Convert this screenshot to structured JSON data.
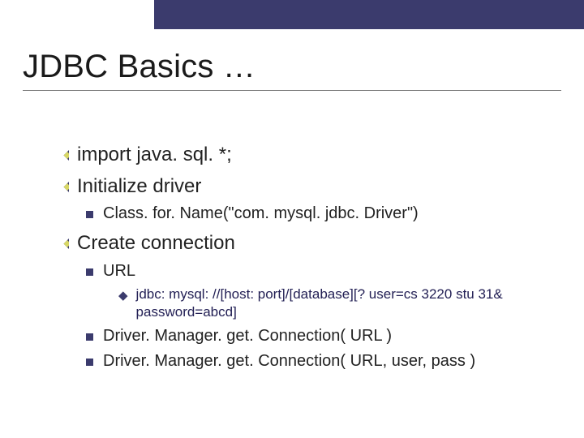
{
  "title": "JDBC Basics …",
  "bullets": {
    "b1": "import java. sql. *;",
    "b2": "Initialize driver",
    "b2a": "Class. for. Name(\"com. mysql. jdbc. Driver\")",
    "b3": "Create connection",
    "b3a": "URL",
    "b3a1": "jdbc: mysql: //[host: port]/[database][? user=cs 3220 stu 31& password=abcd]",
    "b3b": "Driver. Manager. get. Connection( URL )",
    "b3c": "Driver. Manager. get. Connection( URL, user, pass )"
  }
}
